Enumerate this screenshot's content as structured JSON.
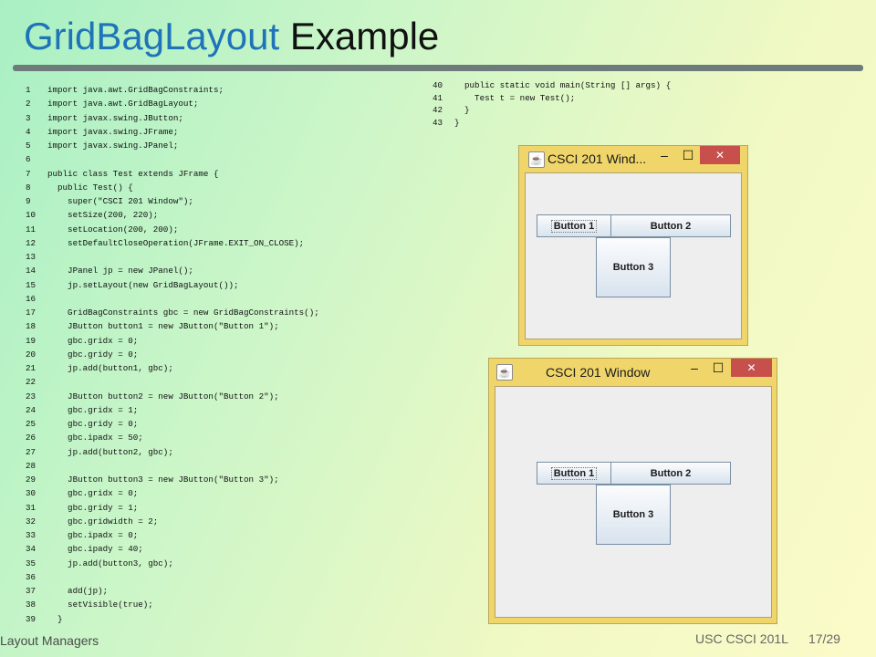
{
  "title": {
    "part1": "GridBagLayout",
    "part2": "Example"
  },
  "code_left": [
    {
      "n": "1",
      "t": "import java.awt.GridBagConstraints;"
    },
    {
      "n": "2",
      "t": "import java.awt.GridBagLayout;"
    },
    {
      "n": "3",
      "t": "import javax.swing.JButton;"
    },
    {
      "n": "4",
      "t": "import javax.swing.JFrame;"
    },
    {
      "n": "5",
      "t": "import javax.swing.JPanel;"
    },
    {
      "n": "6",
      "t": ""
    },
    {
      "n": "7",
      "t": "public class Test extends JFrame {"
    },
    {
      "n": "8",
      "t": "  public Test() {"
    },
    {
      "n": "9",
      "t": "    super(\"CSCI 201 Window\");"
    },
    {
      "n": "10",
      "t": "    setSize(200, 220);"
    },
    {
      "n": "11",
      "t": "    setLocation(200, 200);"
    },
    {
      "n": "12",
      "t": "    setDefaultCloseOperation(JFrame.EXIT_ON_CLOSE);"
    },
    {
      "n": "13",
      "t": ""
    },
    {
      "n": "14",
      "t": "    JPanel jp = new JPanel();"
    },
    {
      "n": "15",
      "t": "    jp.setLayout(new GridBagLayout());"
    },
    {
      "n": "16",
      "t": ""
    },
    {
      "n": "17",
      "t": "    GridBagConstraints gbc = new GridBagConstraints();"
    },
    {
      "n": "18",
      "t": "    JButton button1 = new JButton(\"Button 1\");"
    },
    {
      "n": "19",
      "t": "    gbc.gridx = 0;"
    },
    {
      "n": "20",
      "t": "    gbc.gridy = 0;"
    },
    {
      "n": "21",
      "t": "    jp.add(button1, gbc);"
    },
    {
      "n": "22",
      "t": ""
    },
    {
      "n": "23",
      "t": "    JButton button2 = new JButton(\"Button 2\");"
    },
    {
      "n": "24",
      "t": "    gbc.gridx = 1;"
    },
    {
      "n": "25",
      "t": "    gbc.gridy = 0;"
    },
    {
      "n": "26",
      "t": "    gbc.ipadx = 50;"
    },
    {
      "n": "27",
      "t": "    jp.add(button2, gbc);"
    },
    {
      "n": "28",
      "t": ""
    },
    {
      "n": "29",
      "t": "    JButton button3 = new JButton(\"Button 3\");"
    },
    {
      "n": "30",
      "t": "    gbc.gridx = 0;"
    },
    {
      "n": "31",
      "t": "    gbc.gridy = 1;"
    },
    {
      "n": "32",
      "t": "    gbc.gridwidth = 2;"
    },
    {
      "n": "33",
      "t": "    gbc.ipadx = 0;"
    },
    {
      "n": "34",
      "t": "    gbc.ipady = 40;"
    },
    {
      "n": "35",
      "t": "    jp.add(button3, gbc);"
    },
    {
      "n": "36",
      "t": ""
    },
    {
      "n": "37",
      "t": "    add(jp);"
    },
    {
      "n": "38",
      "t": "    setVisible(true);"
    },
    {
      "n": "39",
      "t": "  }"
    }
  ],
  "code_right": [
    {
      "n": "40",
      "t": "  public static void main(String [] args) {"
    },
    {
      "n": "41",
      "t": "    Test t = new Test();"
    },
    {
      "n": "42",
      "t": "  }"
    },
    {
      "n": "43",
      "t": "}"
    }
  ],
  "window_small": {
    "title": "CSCI 201 Wind...",
    "minimize": "–",
    "maximize": "☐",
    "close": "✕",
    "buttons": [
      "Button 1",
      "Button 2",
      "Button 3"
    ]
  },
  "window_large": {
    "title": "CSCI 201 Window",
    "minimize": "–",
    "maximize": "☐",
    "close": "✕",
    "buttons": [
      "Button 1",
      "Button 2",
      "Button 3"
    ]
  },
  "footer": {
    "left": "Layout Managers",
    "course": "USC CSCI 201L",
    "page": "17/29"
  },
  "colors": {
    "title_blue": "#1f73b8",
    "window_frame": "#f0d66a",
    "close_red": "#c7504c"
  }
}
